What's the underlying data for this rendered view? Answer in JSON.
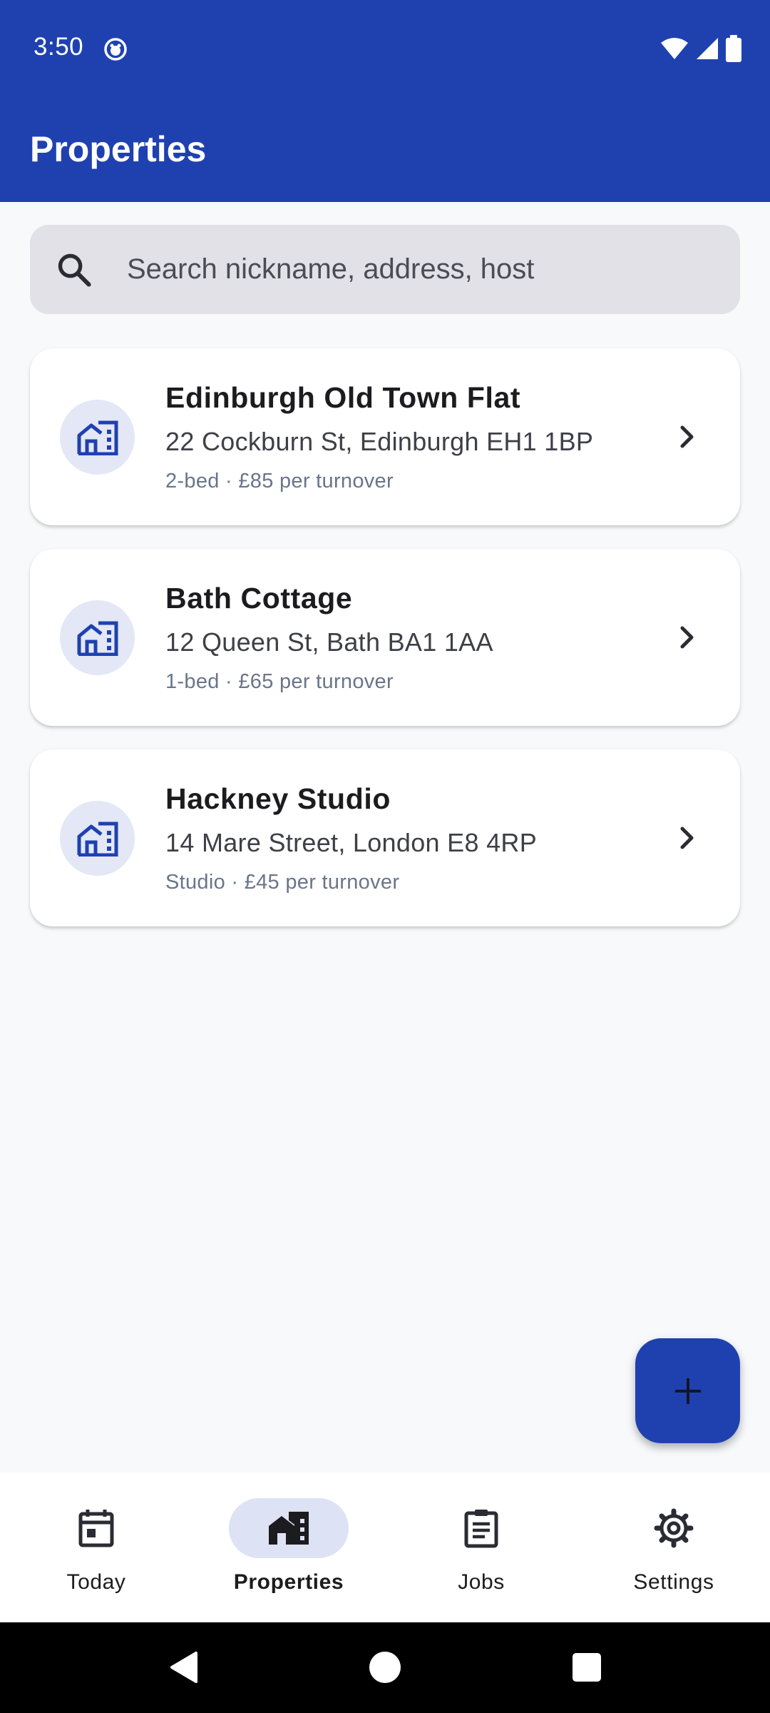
{
  "status_bar": {
    "time": "3:50"
  },
  "app_bar": {
    "title": "Properties"
  },
  "search": {
    "placeholder": "Search nickname, address, host"
  },
  "properties": [
    {
      "name": "Edinburgh Old Town Flat",
      "address": "22 Cockburn St, Edinburgh EH1 1BP",
      "meta": "2-bed · £85 per turnover"
    },
    {
      "name": "Bath Cottage",
      "address": "12 Queen St, Bath BA1 1AA",
      "meta": "1-bed · £65 per turnover"
    },
    {
      "name": "Hackney Studio",
      "address": "14 Mare Street, London E8 4RP",
      "meta": "Studio · £45 per turnover"
    }
  ],
  "bottom_nav": {
    "items": [
      {
        "label": "Today",
        "icon": "calendar-icon",
        "active": false
      },
      {
        "label": "Properties",
        "icon": "house-icon",
        "active": true
      },
      {
        "label": "Jobs",
        "icon": "clipboard-icon",
        "active": false
      },
      {
        "label": "Settings",
        "icon": "gear-icon",
        "active": false
      }
    ]
  },
  "colors": {
    "primary": "#1f41b0",
    "background": "#f8f9fb",
    "avatar_bg": "#e3e7f6",
    "nav_active_pill": "#dde2f4",
    "meta_text": "#697589"
  }
}
